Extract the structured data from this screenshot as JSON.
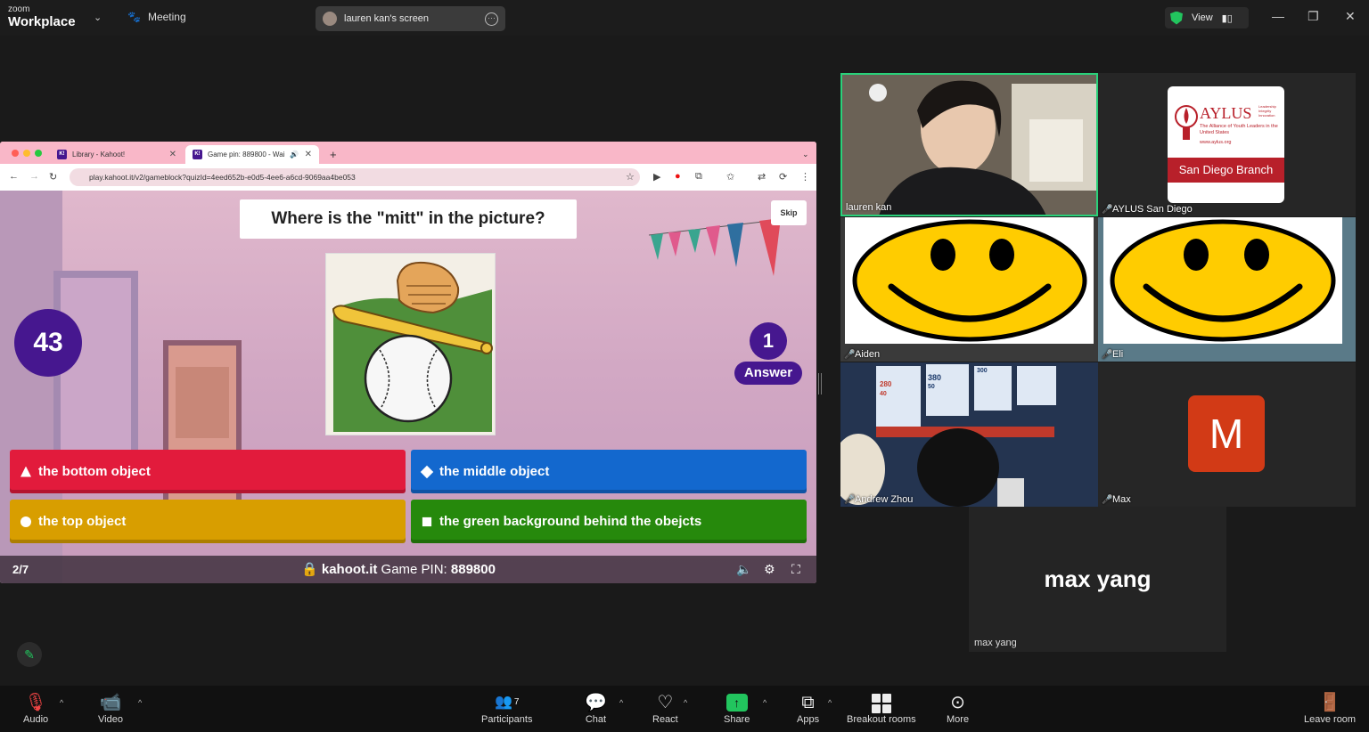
{
  "app": {
    "brand_small": "zoom",
    "brand_large": "Workplace"
  },
  "meeting": {
    "label": "Meeting"
  },
  "screen_pill": {
    "label": "lauren kan's screen"
  },
  "view": {
    "label": "View"
  },
  "browser": {
    "tabs": [
      {
        "label": "Library - Kahoot!"
      },
      {
        "label": "Game pin: 889800 - Wai"
      }
    ],
    "url": "play.kahoot.it/v2/gameblock?quizId=4eed652b-e0d5-4ee6-a6cd-9069aa4be053",
    "favicon_text": "K!"
  },
  "kahoot": {
    "question": "Where is the \"mitt\" in the picture?",
    "skip_label": "Skip",
    "timer": "43",
    "answer_count": "1",
    "answer_label": "Answer",
    "answers": [
      {
        "label": "the bottom object",
        "color": "#e21b3c",
        "shape": "triangle"
      },
      {
        "label": "the middle object",
        "color": "#1368ce",
        "shape": "diamond"
      },
      {
        "label": "the top object",
        "color": "#d89e00",
        "shape": "circle"
      },
      {
        "label": "the green background behind the obejcts",
        "color": "#26890c",
        "shape": "square"
      }
    ],
    "progress": "2/7",
    "site": "kahoot.it",
    "pin_label": "Game PIN:",
    "pin": "889800",
    "purple": "#46178f"
  },
  "participants_tiles": [
    {
      "name": "lauren kan",
      "muted": false,
      "active_speaker": true
    },
    {
      "name": "AYLUS San Diego",
      "muted": true
    },
    {
      "name": "Aiden",
      "muted": true
    },
    {
      "name": "Eli",
      "muted": true
    },
    {
      "name": "Andrew Zhou",
      "muted": true
    },
    {
      "name": "Max",
      "muted": true,
      "avatar_letter": "M"
    }
  ],
  "aylus": {
    "title": "AYLUS",
    "tagline": "The Alliance of Youth Leaders in the United States",
    "site": "www.aylus.org",
    "side_words": "Leadership Integrity Innovation",
    "branch": "San Diego Branch"
  },
  "andrew_video_signs": [
    "380",
    "50",
    "280",
    "40",
    "300"
  ],
  "max_yang": {
    "big": "max yang",
    "small": "max yang"
  },
  "toolbar": {
    "audio": "Audio",
    "video": "Video",
    "participants": "Participants",
    "participants_count": "7",
    "chat": "Chat",
    "react": "React",
    "share": "Share",
    "apps": "Apps",
    "breakout": "Breakout rooms",
    "more": "More",
    "leave": "Leave room"
  },
  "colors": {
    "zoom_green": "#22c55e",
    "muted_red": "#ef4444",
    "max_avatar": "#d23a16"
  }
}
